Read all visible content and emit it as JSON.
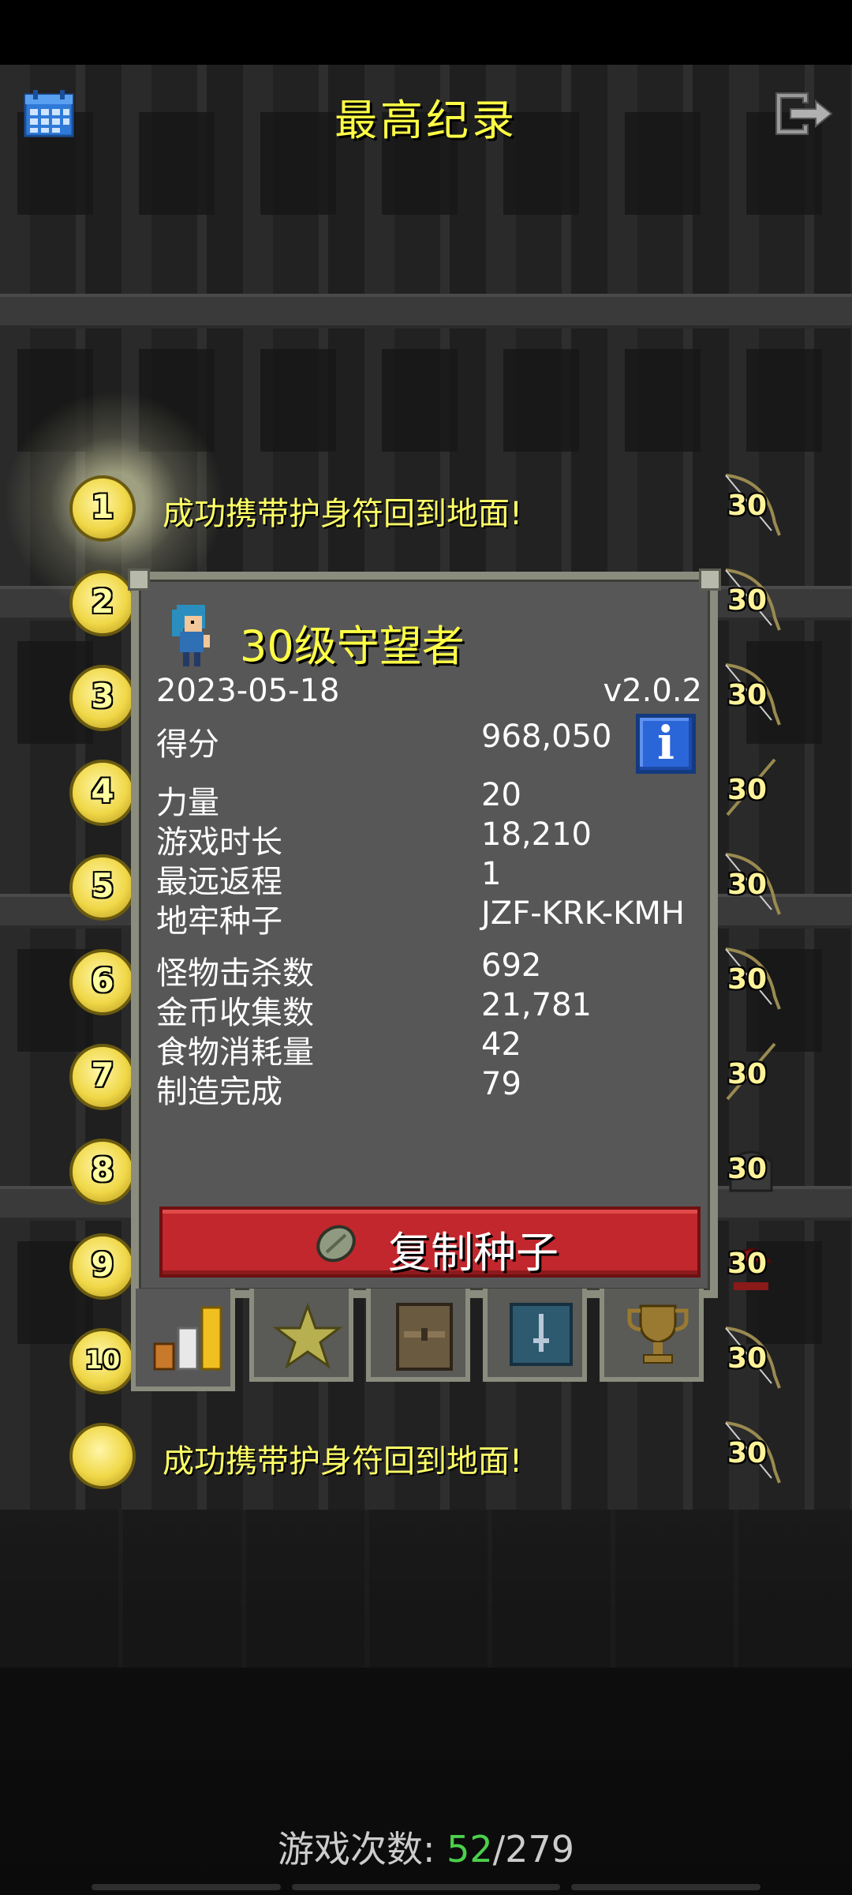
{
  "screen": {
    "title": "最高纪录",
    "calendar_icon": "calendar-icon",
    "exit_icon": "exit-icon"
  },
  "rankings": [
    {
      "rank": "1",
      "description": "成功携带护身符回到地面!",
      "level": "30",
      "class_icon": "bow-icon"
    },
    {
      "rank": "2",
      "description": "",
      "level": "30",
      "class_icon": "bow-icon"
    },
    {
      "rank": "3",
      "description": "",
      "level": "30",
      "class_icon": "bow-icon"
    },
    {
      "rank": "4",
      "description": "",
      "level": "30",
      "class_icon": "bow-icon"
    },
    {
      "rank": "5",
      "description": "",
      "level": "30",
      "class_icon": "bow-icon"
    },
    {
      "rank": "6",
      "description": "",
      "level": "30",
      "class_icon": "bow-icon"
    },
    {
      "rank": "7",
      "description": "",
      "level": "30",
      "class_icon": "bow-icon"
    },
    {
      "rank": "8",
      "description": "",
      "level": "30",
      "class_icon": "helmet-icon"
    },
    {
      "rank": "9",
      "description": "",
      "level": "30",
      "class_icon": "mage-icon"
    },
    {
      "rank": "10",
      "description": "",
      "level": "30",
      "class_icon": "bow-icon"
    },
    {
      "rank": "",
      "description": "成功携带护身符回到地面!",
      "level": "30",
      "class_icon": "bow-icon"
    }
  ],
  "detail": {
    "name": "30级守望者",
    "date": "2023-05-18",
    "version": "v2.0.2",
    "stats_group1": [
      {
        "label": "得分",
        "value": "968,050"
      }
    ],
    "stats_group2": [
      {
        "label": "力量",
        "value": "20"
      },
      {
        "label": "游戏时长",
        "value": "18,210"
      },
      {
        "label": "最远返程",
        "value": "1"
      },
      {
        "label": "地牢种子",
        "value": "JZF-KRK-KMH"
      }
    ],
    "stats_group3": [
      {
        "label": "怪物击杀数",
        "value": "692"
      },
      {
        "label": "金币收集数",
        "value": "21,781"
      },
      {
        "label": "食物消耗量",
        "value": "42"
      },
      {
        "label": "制造完成",
        "value": "79"
      }
    ],
    "info_button": "i",
    "copy_seed_button": "复制种子"
  },
  "tabs": [
    {
      "icon": "stats-chart-icon",
      "active": true
    },
    {
      "icon": "badge-star-icon",
      "active": false
    },
    {
      "icon": "backpack-icon",
      "active": false
    },
    {
      "icon": "dungeon-icon",
      "active": false
    },
    {
      "icon": "trophy-icon",
      "active": false
    }
  ],
  "footer": {
    "label": "游戏次数:",
    "current": "52",
    "separator": "/",
    "total": "279"
  },
  "colors": {
    "title_yellow": "#ffff44",
    "copy_button_red": "#c1272d",
    "info_button_blue": "#2b66d9",
    "games_count_green": "#4bd04b"
  }
}
